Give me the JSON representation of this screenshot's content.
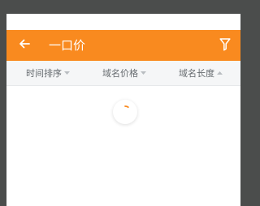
{
  "appbar": {
    "title": "一口价",
    "back_icon": "arrow-left-icon",
    "filter_icon": "filter-icon"
  },
  "sortbar": {
    "items": [
      {
        "label": "时间排序",
        "icon": "caret-down-icon"
      },
      {
        "label": "域名价格",
        "icon": "caret-down-icon"
      },
      {
        "label": "域名长度",
        "icon": "caret-up-icon"
      }
    ]
  },
  "loader": {
    "icon": "loading-spinner-icon"
  },
  "colors": {
    "accent": "#f98a1f",
    "spinner": "#f98a1f",
    "backdrop": "#4b4d4c",
    "sortbar": "#f5f6f7"
  }
}
